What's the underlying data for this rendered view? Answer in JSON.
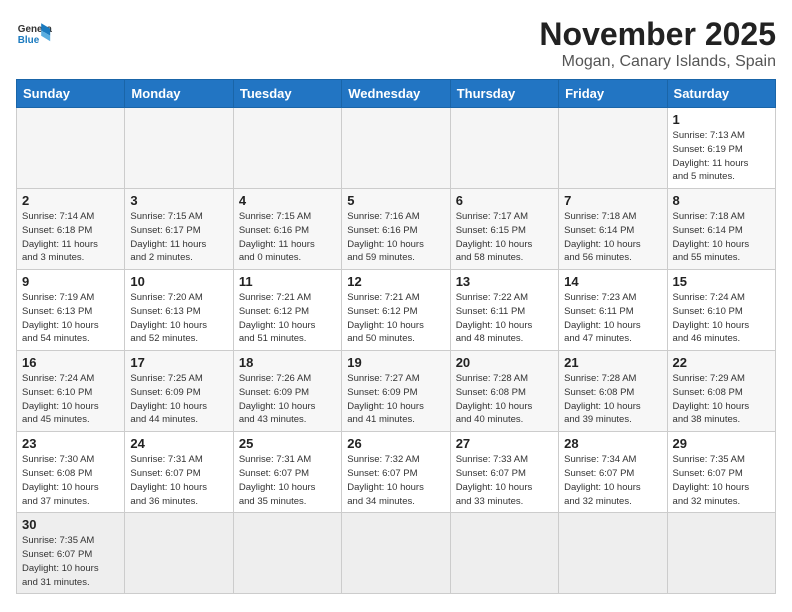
{
  "header": {
    "logo_general": "General",
    "logo_blue": "Blue",
    "title": "November 2025",
    "subtitle": "Mogan, Canary Islands, Spain"
  },
  "days_of_week": [
    "Sunday",
    "Monday",
    "Tuesday",
    "Wednesday",
    "Thursday",
    "Friday",
    "Saturday"
  ],
  "weeks": [
    [
      {
        "day": "",
        "info": ""
      },
      {
        "day": "",
        "info": ""
      },
      {
        "day": "",
        "info": ""
      },
      {
        "day": "",
        "info": ""
      },
      {
        "day": "",
        "info": ""
      },
      {
        "day": "",
        "info": ""
      },
      {
        "day": "1",
        "info": "Sunrise: 7:13 AM\nSunset: 6:19 PM\nDaylight: 11 hours\nand 5 minutes."
      }
    ],
    [
      {
        "day": "2",
        "info": "Sunrise: 7:14 AM\nSunset: 6:18 PM\nDaylight: 11 hours\nand 3 minutes."
      },
      {
        "day": "3",
        "info": "Sunrise: 7:15 AM\nSunset: 6:17 PM\nDaylight: 11 hours\nand 2 minutes."
      },
      {
        "day": "4",
        "info": "Sunrise: 7:15 AM\nSunset: 6:16 PM\nDaylight: 11 hours\nand 0 minutes."
      },
      {
        "day": "5",
        "info": "Sunrise: 7:16 AM\nSunset: 6:16 PM\nDaylight: 10 hours\nand 59 minutes."
      },
      {
        "day": "6",
        "info": "Sunrise: 7:17 AM\nSunset: 6:15 PM\nDaylight: 10 hours\nand 58 minutes."
      },
      {
        "day": "7",
        "info": "Sunrise: 7:18 AM\nSunset: 6:14 PM\nDaylight: 10 hours\nand 56 minutes."
      },
      {
        "day": "8",
        "info": "Sunrise: 7:18 AM\nSunset: 6:14 PM\nDaylight: 10 hours\nand 55 minutes."
      }
    ],
    [
      {
        "day": "9",
        "info": "Sunrise: 7:19 AM\nSunset: 6:13 PM\nDaylight: 10 hours\nand 54 minutes."
      },
      {
        "day": "10",
        "info": "Sunrise: 7:20 AM\nSunset: 6:13 PM\nDaylight: 10 hours\nand 52 minutes."
      },
      {
        "day": "11",
        "info": "Sunrise: 7:21 AM\nSunset: 6:12 PM\nDaylight: 10 hours\nand 51 minutes."
      },
      {
        "day": "12",
        "info": "Sunrise: 7:21 AM\nSunset: 6:12 PM\nDaylight: 10 hours\nand 50 minutes."
      },
      {
        "day": "13",
        "info": "Sunrise: 7:22 AM\nSunset: 6:11 PM\nDaylight: 10 hours\nand 48 minutes."
      },
      {
        "day": "14",
        "info": "Sunrise: 7:23 AM\nSunset: 6:11 PM\nDaylight: 10 hours\nand 47 minutes."
      },
      {
        "day": "15",
        "info": "Sunrise: 7:24 AM\nSunset: 6:10 PM\nDaylight: 10 hours\nand 46 minutes."
      }
    ],
    [
      {
        "day": "16",
        "info": "Sunrise: 7:24 AM\nSunset: 6:10 PM\nDaylight: 10 hours\nand 45 minutes."
      },
      {
        "day": "17",
        "info": "Sunrise: 7:25 AM\nSunset: 6:09 PM\nDaylight: 10 hours\nand 44 minutes."
      },
      {
        "day": "18",
        "info": "Sunrise: 7:26 AM\nSunset: 6:09 PM\nDaylight: 10 hours\nand 43 minutes."
      },
      {
        "day": "19",
        "info": "Sunrise: 7:27 AM\nSunset: 6:09 PM\nDaylight: 10 hours\nand 41 minutes."
      },
      {
        "day": "20",
        "info": "Sunrise: 7:28 AM\nSunset: 6:08 PM\nDaylight: 10 hours\nand 40 minutes."
      },
      {
        "day": "21",
        "info": "Sunrise: 7:28 AM\nSunset: 6:08 PM\nDaylight: 10 hours\nand 39 minutes."
      },
      {
        "day": "22",
        "info": "Sunrise: 7:29 AM\nSunset: 6:08 PM\nDaylight: 10 hours\nand 38 minutes."
      }
    ],
    [
      {
        "day": "23",
        "info": "Sunrise: 7:30 AM\nSunset: 6:08 PM\nDaylight: 10 hours\nand 37 minutes."
      },
      {
        "day": "24",
        "info": "Sunrise: 7:31 AM\nSunset: 6:07 PM\nDaylight: 10 hours\nand 36 minutes."
      },
      {
        "day": "25",
        "info": "Sunrise: 7:31 AM\nSunset: 6:07 PM\nDaylight: 10 hours\nand 35 minutes."
      },
      {
        "day": "26",
        "info": "Sunrise: 7:32 AM\nSunset: 6:07 PM\nDaylight: 10 hours\nand 34 minutes."
      },
      {
        "day": "27",
        "info": "Sunrise: 7:33 AM\nSunset: 6:07 PM\nDaylight: 10 hours\nand 33 minutes."
      },
      {
        "day": "28",
        "info": "Sunrise: 7:34 AM\nSunset: 6:07 PM\nDaylight: 10 hours\nand 32 minutes."
      },
      {
        "day": "29",
        "info": "Sunrise: 7:35 AM\nSunset: 6:07 PM\nDaylight: 10 hours\nand 32 minutes."
      }
    ],
    [
      {
        "day": "30",
        "info": "Sunrise: 7:35 AM\nSunset: 6:07 PM\nDaylight: 10 hours\nand 31 minutes."
      },
      {
        "day": "",
        "info": ""
      },
      {
        "day": "",
        "info": ""
      },
      {
        "day": "",
        "info": ""
      },
      {
        "day": "",
        "info": ""
      },
      {
        "day": "",
        "info": ""
      },
      {
        "day": "",
        "info": ""
      }
    ]
  ]
}
